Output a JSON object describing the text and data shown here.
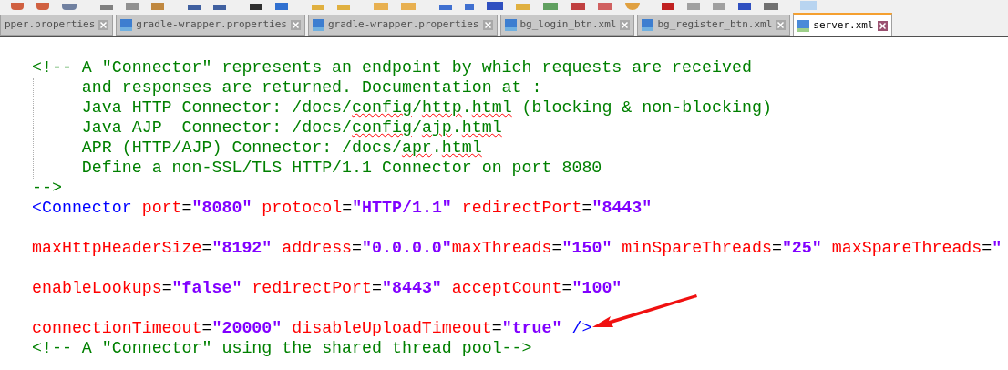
{
  "tabs": [
    {
      "label": "pper.properties",
      "selected": false,
      "icon": false
    },
    {
      "label": "gradle-wrapper.properties",
      "selected": false,
      "icon": true
    },
    {
      "label": "gradle-wrapper.properties",
      "selected": false,
      "icon": true
    },
    {
      "label": "bg_login_btn.xml",
      "selected": false,
      "icon": true
    },
    {
      "label": "bg_register_btn.xml",
      "selected": false,
      "icon": true
    },
    {
      "label": "server.xml",
      "selected": true,
      "icon": true
    }
  ],
  "editor": {
    "lines": [
      {
        "blank_before": false,
        "tokens": [
          {
            "kind": "comment",
            "text": "<!-- A \"Connector\" represents an endpoint by which requests are received"
          }
        ]
      },
      {
        "blank_before": false,
        "tokens": [
          {
            "kind": "comment",
            "text": "     and responses are returned. Documentation at :"
          }
        ]
      },
      {
        "blank_before": false,
        "tokens": [
          {
            "kind": "comment",
            "text": "     Java HTTP Connector: /docs/"
          },
          {
            "kind": "comment",
            "text": "config",
            "misspelled": true
          },
          {
            "kind": "comment",
            "text": "/"
          },
          {
            "kind": "comment",
            "text": "http",
            "misspelled": true
          },
          {
            "kind": "comment",
            "text": "."
          },
          {
            "kind": "comment",
            "text": "html",
            "misspelled": true
          },
          {
            "kind": "comment",
            "text": " (blocking & non-blocking)"
          }
        ]
      },
      {
        "blank_before": false,
        "tokens": [
          {
            "kind": "comment",
            "text": "     Java AJP  Connector: /docs/"
          },
          {
            "kind": "comment",
            "text": "config",
            "misspelled": true
          },
          {
            "kind": "comment",
            "text": "/"
          },
          {
            "kind": "comment",
            "text": "ajp",
            "misspelled": true
          },
          {
            "kind": "comment",
            "text": "."
          },
          {
            "kind": "comment",
            "text": "html",
            "misspelled": true
          }
        ]
      },
      {
        "blank_before": false,
        "tokens": [
          {
            "kind": "comment",
            "text": "     APR (HTTP/AJP) Connector: /docs/"
          },
          {
            "kind": "comment",
            "text": "apr",
            "misspelled": true
          },
          {
            "kind": "comment",
            "text": "."
          },
          {
            "kind": "comment",
            "text": "html",
            "misspelled": true
          }
        ]
      },
      {
        "blank_before": false,
        "tokens": [
          {
            "kind": "comment",
            "text": "     Define a non-SSL/TLS HTTP/1.1 Connector on port 8080"
          }
        ]
      },
      {
        "blank_before": false,
        "tokens": [
          {
            "kind": "comment",
            "text": "-->"
          }
        ]
      },
      {
        "blank_before": false,
        "tokens": [
          {
            "kind": "tag",
            "text": "<Connector"
          },
          {
            "kind": "attr",
            "text": " port"
          },
          {
            "kind": "eq",
            "text": "="
          },
          {
            "kind": "value",
            "text": "\"8080\""
          },
          {
            "kind": "attr",
            "text": " protocol"
          },
          {
            "kind": "eq",
            "text": "="
          },
          {
            "kind": "value",
            "text": "\"HTTP/1.1\""
          },
          {
            "kind": "attr",
            "text": " redirectPort"
          },
          {
            "kind": "eq",
            "text": "="
          },
          {
            "kind": "value",
            "text": "\"8443\""
          }
        ]
      },
      {
        "blank_before": true,
        "tokens": [
          {
            "kind": "attr",
            "text": "maxHttpHeaderSize"
          },
          {
            "kind": "eq",
            "text": "="
          },
          {
            "kind": "value",
            "text": "\"8192\""
          },
          {
            "kind": "attr",
            "text": " address"
          },
          {
            "kind": "eq",
            "text": "="
          },
          {
            "kind": "value",
            "text": "\"0.0.0.0\""
          },
          {
            "kind": "attr",
            "text": "maxThreads"
          },
          {
            "kind": "eq",
            "text": "="
          },
          {
            "kind": "value",
            "text": "\"150\""
          },
          {
            "kind": "attr",
            "text": " minSpareThreads"
          },
          {
            "kind": "eq",
            "text": "="
          },
          {
            "kind": "value",
            "text": "\"25\""
          },
          {
            "kind": "attr",
            "text": " maxSpareThreads"
          },
          {
            "kind": "eq",
            "text": "="
          },
          {
            "kind": "value",
            "text": "\""
          }
        ]
      },
      {
        "blank_before": true,
        "tokens": [
          {
            "kind": "attr",
            "text": "enableLookups"
          },
          {
            "kind": "eq",
            "text": "="
          },
          {
            "kind": "value",
            "text": "\"false\""
          },
          {
            "kind": "attr",
            "text": " redirectPort"
          },
          {
            "kind": "eq",
            "text": "="
          },
          {
            "kind": "value",
            "text": "\"8443\""
          },
          {
            "kind": "attr",
            "text": " acceptCount"
          },
          {
            "kind": "eq",
            "text": "="
          },
          {
            "kind": "value",
            "text": "\"100\""
          }
        ]
      },
      {
        "blank_before": true,
        "tokens": [
          {
            "kind": "attr",
            "text": "connectionTimeout"
          },
          {
            "kind": "eq",
            "text": "="
          },
          {
            "kind": "value",
            "text": "\"20000\""
          },
          {
            "kind": "attr",
            "text": " disableUploadTimeout"
          },
          {
            "kind": "eq",
            "text": "="
          },
          {
            "kind": "value",
            "text": "\"true\""
          },
          {
            "kind": "tag",
            "text": " />"
          }
        ]
      },
      {
        "blank_before": false,
        "tokens": [
          {
            "kind": "comment",
            "text": "<!-- A \"Connector\" using the shared thread pool-->"
          }
        ]
      }
    ]
  }
}
